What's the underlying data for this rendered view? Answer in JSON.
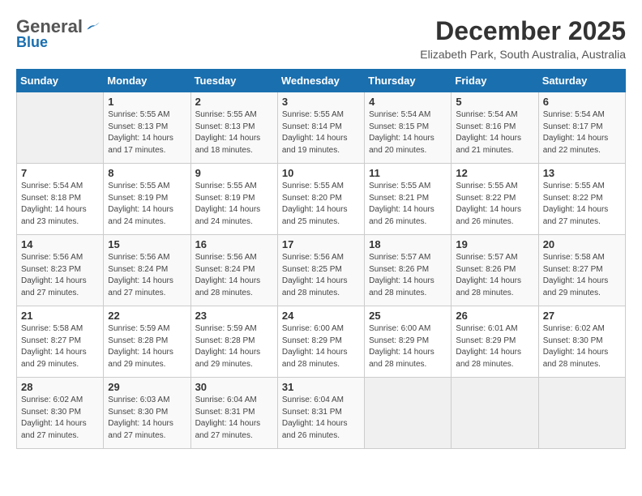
{
  "header": {
    "logo_general": "General",
    "logo_blue": "Blue",
    "month_title": "December 2025",
    "location": "Elizabeth Park, South Australia, Australia"
  },
  "days_of_week": [
    "Sunday",
    "Monday",
    "Tuesday",
    "Wednesday",
    "Thursday",
    "Friday",
    "Saturday"
  ],
  "weeks": [
    [
      {
        "day": "",
        "info": ""
      },
      {
        "day": "1",
        "info": "Sunrise: 5:55 AM\nSunset: 8:13 PM\nDaylight: 14 hours\nand 17 minutes."
      },
      {
        "day": "2",
        "info": "Sunrise: 5:55 AM\nSunset: 8:13 PM\nDaylight: 14 hours\nand 18 minutes."
      },
      {
        "day": "3",
        "info": "Sunrise: 5:55 AM\nSunset: 8:14 PM\nDaylight: 14 hours\nand 19 minutes."
      },
      {
        "day": "4",
        "info": "Sunrise: 5:54 AM\nSunset: 8:15 PM\nDaylight: 14 hours\nand 20 minutes."
      },
      {
        "day": "5",
        "info": "Sunrise: 5:54 AM\nSunset: 8:16 PM\nDaylight: 14 hours\nand 21 minutes."
      },
      {
        "day": "6",
        "info": "Sunrise: 5:54 AM\nSunset: 8:17 PM\nDaylight: 14 hours\nand 22 minutes."
      }
    ],
    [
      {
        "day": "7",
        "info": "Sunrise: 5:54 AM\nSunset: 8:18 PM\nDaylight: 14 hours\nand 23 minutes."
      },
      {
        "day": "8",
        "info": "Sunrise: 5:55 AM\nSunset: 8:19 PM\nDaylight: 14 hours\nand 24 minutes."
      },
      {
        "day": "9",
        "info": "Sunrise: 5:55 AM\nSunset: 8:19 PM\nDaylight: 14 hours\nand 24 minutes."
      },
      {
        "day": "10",
        "info": "Sunrise: 5:55 AM\nSunset: 8:20 PM\nDaylight: 14 hours\nand 25 minutes."
      },
      {
        "day": "11",
        "info": "Sunrise: 5:55 AM\nSunset: 8:21 PM\nDaylight: 14 hours\nand 26 minutes."
      },
      {
        "day": "12",
        "info": "Sunrise: 5:55 AM\nSunset: 8:22 PM\nDaylight: 14 hours\nand 26 minutes."
      },
      {
        "day": "13",
        "info": "Sunrise: 5:55 AM\nSunset: 8:22 PM\nDaylight: 14 hours\nand 27 minutes."
      }
    ],
    [
      {
        "day": "14",
        "info": "Sunrise: 5:56 AM\nSunset: 8:23 PM\nDaylight: 14 hours\nand 27 minutes."
      },
      {
        "day": "15",
        "info": "Sunrise: 5:56 AM\nSunset: 8:24 PM\nDaylight: 14 hours\nand 27 minutes."
      },
      {
        "day": "16",
        "info": "Sunrise: 5:56 AM\nSunset: 8:24 PM\nDaylight: 14 hours\nand 28 minutes."
      },
      {
        "day": "17",
        "info": "Sunrise: 5:56 AM\nSunset: 8:25 PM\nDaylight: 14 hours\nand 28 minutes."
      },
      {
        "day": "18",
        "info": "Sunrise: 5:57 AM\nSunset: 8:26 PM\nDaylight: 14 hours\nand 28 minutes."
      },
      {
        "day": "19",
        "info": "Sunrise: 5:57 AM\nSunset: 8:26 PM\nDaylight: 14 hours\nand 28 minutes."
      },
      {
        "day": "20",
        "info": "Sunrise: 5:58 AM\nSunset: 8:27 PM\nDaylight: 14 hours\nand 29 minutes."
      }
    ],
    [
      {
        "day": "21",
        "info": "Sunrise: 5:58 AM\nSunset: 8:27 PM\nDaylight: 14 hours\nand 29 minutes."
      },
      {
        "day": "22",
        "info": "Sunrise: 5:59 AM\nSunset: 8:28 PM\nDaylight: 14 hours\nand 29 minutes."
      },
      {
        "day": "23",
        "info": "Sunrise: 5:59 AM\nSunset: 8:28 PM\nDaylight: 14 hours\nand 29 minutes."
      },
      {
        "day": "24",
        "info": "Sunrise: 6:00 AM\nSunset: 8:29 PM\nDaylight: 14 hours\nand 28 minutes."
      },
      {
        "day": "25",
        "info": "Sunrise: 6:00 AM\nSunset: 8:29 PM\nDaylight: 14 hours\nand 28 minutes."
      },
      {
        "day": "26",
        "info": "Sunrise: 6:01 AM\nSunset: 8:29 PM\nDaylight: 14 hours\nand 28 minutes."
      },
      {
        "day": "27",
        "info": "Sunrise: 6:02 AM\nSunset: 8:30 PM\nDaylight: 14 hours\nand 28 minutes."
      }
    ],
    [
      {
        "day": "28",
        "info": "Sunrise: 6:02 AM\nSunset: 8:30 PM\nDaylight: 14 hours\nand 27 minutes."
      },
      {
        "day": "29",
        "info": "Sunrise: 6:03 AM\nSunset: 8:30 PM\nDaylight: 14 hours\nand 27 minutes."
      },
      {
        "day": "30",
        "info": "Sunrise: 6:04 AM\nSunset: 8:31 PM\nDaylight: 14 hours\nand 27 minutes."
      },
      {
        "day": "31",
        "info": "Sunrise: 6:04 AM\nSunset: 8:31 PM\nDaylight: 14 hours\nand 26 minutes."
      },
      {
        "day": "",
        "info": ""
      },
      {
        "day": "",
        "info": ""
      },
      {
        "day": "",
        "info": ""
      }
    ]
  ]
}
